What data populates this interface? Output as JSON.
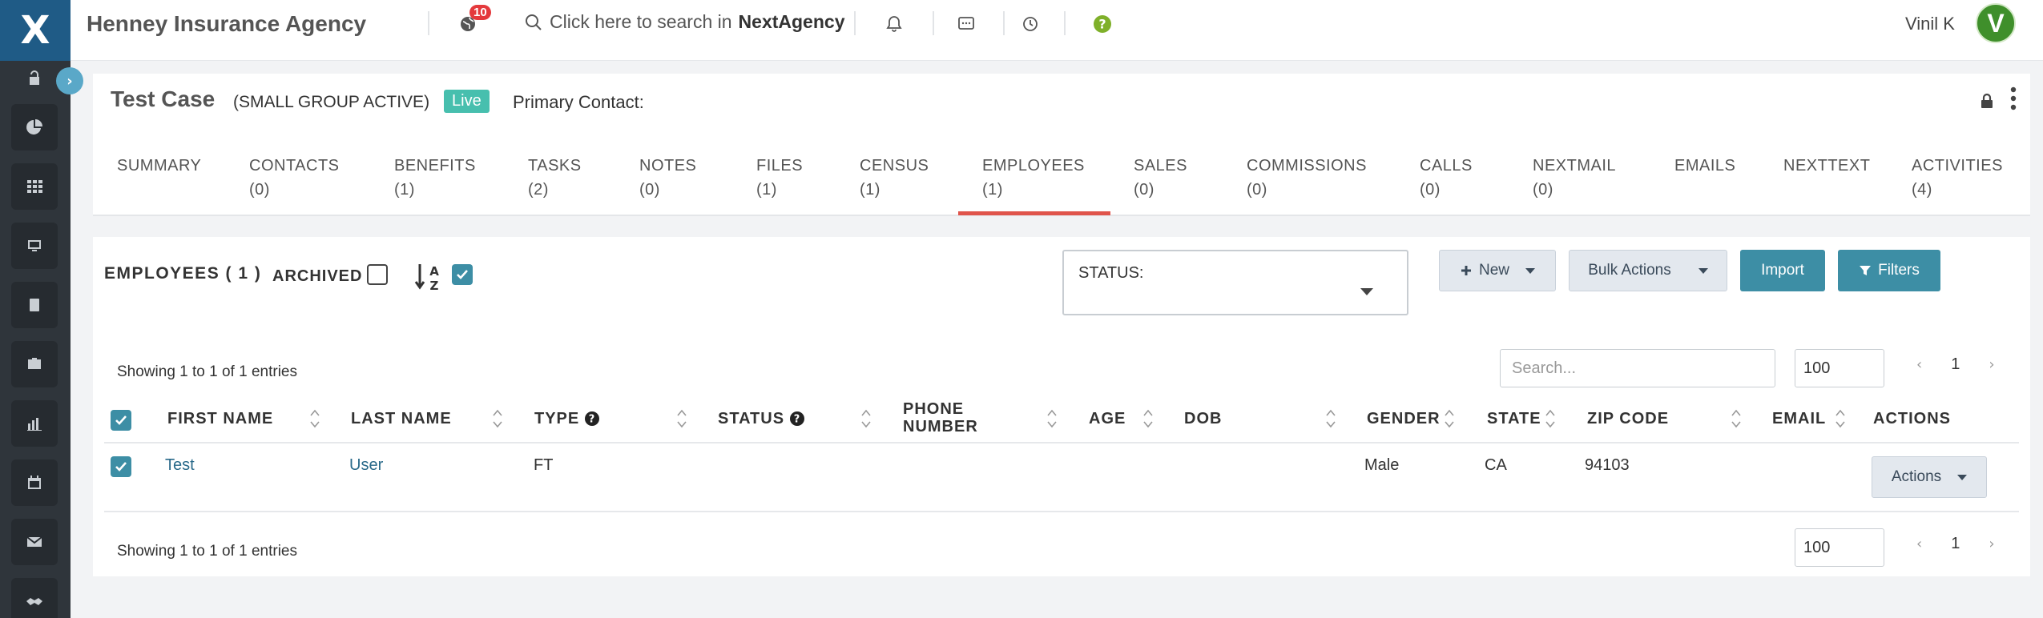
{
  "header": {
    "agency_name": "Henney Insurance Agency",
    "notification_count": "10",
    "search_prefix": "Click here to search in",
    "search_brand": "NextAgency",
    "user_name": "Vinil K",
    "avatar_letter": "V"
  },
  "sidebar": {
    "logo": "X",
    "toggle": "›",
    "items": [
      "lock-open-icon",
      "pie-chart-icon",
      "grid-icon",
      "monitor-icon",
      "book-icon",
      "briefcase-icon",
      "bar-chart-icon",
      "calendar-check-icon",
      "envelope-icon",
      "handshake-icon"
    ]
  },
  "case": {
    "title": "Test Case",
    "type": "(SMALL GROUP ACTIVE)",
    "status_badge": "Live",
    "primary_contact_label": "Primary Contact:"
  },
  "tabs": [
    {
      "label": "SUMMARY",
      "count": ""
    },
    {
      "label": "CONTACTS",
      "count": "(0)"
    },
    {
      "label": "BENEFITS",
      "count": "(1)"
    },
    {
      "label": "TASKS",
      "count": "(2)"
    },
    {
      "label": "NOTES",
      "count": "(0)"
    },
    {
      "label": "FILES",
      "count": "(1)"
    },
    {
      "label": "CENSUS",
      "count": "(1)"
    },
    {
      "label": "EMPLOYEES",
      "count": "(1)"
    },
    {
      "label": "SALES",
      "count": "(0)"
    },
    {
      "label": "COMMISSIONS",
      "count": "(0)"
    },
    {
      "label": "CALLS",
      "count": "(0)"
    },
    {
      "label": "NEXTMAIL",
      "count": "(0)"
    },
    {
      "label": "EMAILS",
      "count": ""
    },
    {
      "label": "NEXTTEXT",
      "count": ""
    },
    {
      "label": "ACTIVITIES",
      "count": "(4)"
    }
  ],
  "active_tab": "EMPLOYEES",
  "employees": {
    "title": "EMPLOYEES ( 1 )",
    "archived_label": "ARCHIVED",
    "status_label": "STATUS:",
    "buttons": {
      "new": "New",
      "bulk": "Bulk Actions",
      "import": "Import",
      "filters": "Filters"
    },
    "showing_top": "Showing 1 to 1 of 1 entries",
    "showing_bottom": "Showing 1 to 1 of 1 entries",
    "search_placeholder": "Search...",
    "page_size": "100",
    "page": "1",
    "columns": [
      "FIRST NAME",
      "LAST NAME",
      "TYPE",
      "STATUS",
      "PHONE NUMBER",
      "AGE",
      "DOB",
      "GENDER",
      "STATE",
      "ZIP CODE",
      "EMAIL",
      "ACTIONS"
    ],
    "rows": [
      {
        "first_name": "Test",
        "last_name": "User",
        "type": "FT",
        "status": "",
        "phone": "",
        "age": "",
        "dob": "",
        "gender": "Male",
        "state": "CA",
        "zip": "94103",
        "email": "",
        "action_label": "Actions"
      }
    ]
  },
  "colors": {
    "teal": "#3d8ea5",
    "live": "#47bfae",
    "active_tab": "#e0544b",
    "sidebar": "#2f353b",
    "logo_bg": "#1f5b86",
    "avatar": "#3f8f2b"
  }
}
